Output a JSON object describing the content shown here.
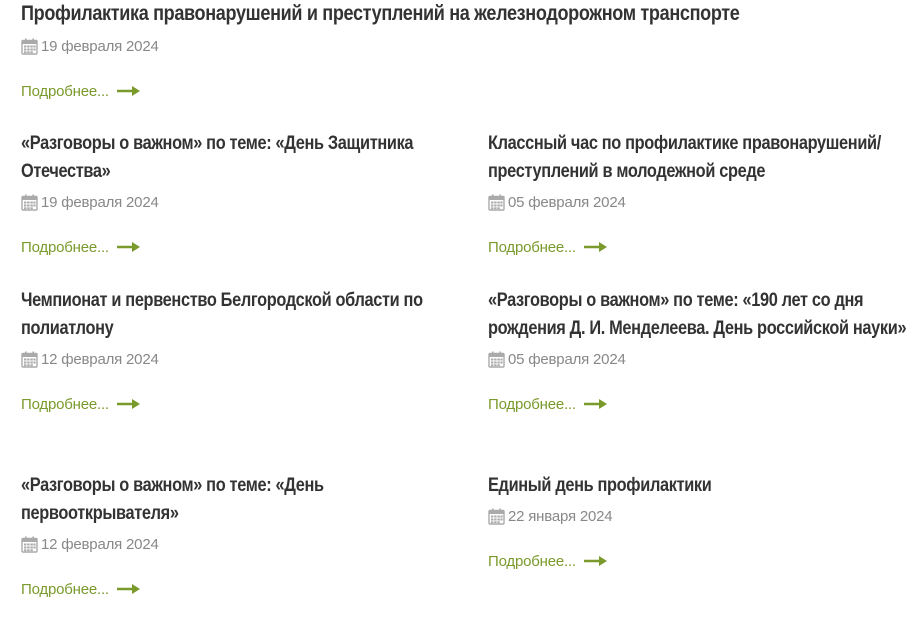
{
  "news": {
    "more_label": "Подробнее...",
    "accent_color": "#7a9a2c",
    "date_color": "#888888",
    "items": [
      {
        "title": "Профилактика правонарушений и преступлений на железнодорожном транспорте",
        "date": "19 февраля 2024"
      },
      {
        "title": "«Разговоры о важном» по теме: «День Защитника Отечества»",
        "date": "19 февраля 2024"
      },
      {
        "title": "Классный час по профилактике правонарушений/преступлений в молодежной среде",
        "date": "05 февраля 2024"
      },
      {
        "title": "Чемпионат и первенство Белгородской области по полиатлону",
        "date": "12 февраля 2024"
      },
      {
        "title": "«Разговоры о важном» по теме: «190 лет со дня рождения Д. И. Менделеева. День российской науки»",
        "date": "05 февраля 2024"
      },
      {
        "title": "«Разговоры о важном» по теме: «День первооткрывателя»",
        "date": "12 февраля 2024"
      },
      {
        "title": "Единый день профилактики",
        "date": "22 января 2024"
      }
    ]
  }
}
